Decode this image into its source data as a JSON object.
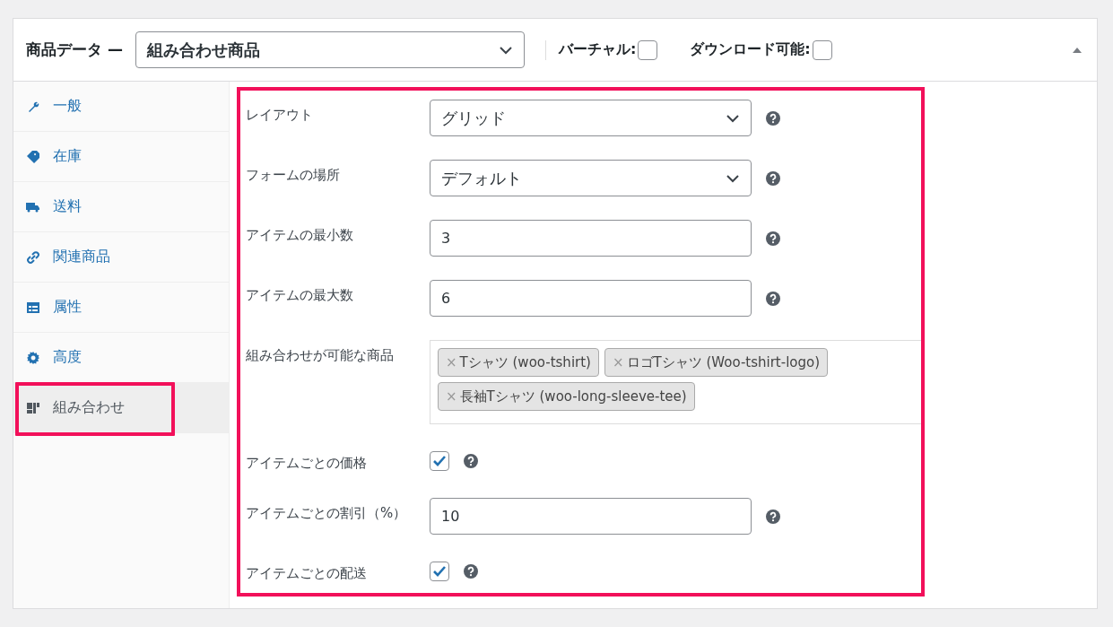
{
  "header": {
    "title": "商品データ —",
    "product_type": "組み合わせ商品",
    "options": [
      {
        "label": "バーチャル:",
        "checked": false
      },
      {
        "label": "ダウンロード可能:",
        "checked": false
      }
    ],
    "expanded": true
  },
  "tabs": [
    {
      "label": "一般",
      "selected": false,
      "highlighted": false
    },
    {
      "label": "在庫",
      "selected": false,
      "highlighted": false
    },
    {
      "label": "送料",
      "selected": false,
      "highlighted": false
    },
    {
      "label": "関連商品",
      "selected": false,
      "highlighted": false
    },
    {
      "label": "属性",
      "selected": false,
      "highlighted": false
    },
    {
      "label": "高度",
      "selected": false,
      "highlighted": false
    },
    {
      "label": "組み合わせ",
      "selected": true,
      "highlighted": true
    }
  ],
  "settings": {
    "highlighted": true,
    "fields": [
      {
        "kind": "select",
        "label": "レイアウト",
        "value": "グリッド"
      },
      {
        "kind": "select",
        "label": "フォームの場所",
        "value": "デフォルト"
      },
      {
        "kind": "number",
        "label": "アイテムの最小数",
        "value": "3"
      },
      {
        "kind": "number",
        "label": "アイテムの最大数",
        "value": "6"
      },
      {
        "kind": "tags",
        "label": "組み合わせが可能な商品",
        "tags": [
          {
            "remove": "×",
            "text": "Tシャツ (woo-tshirt)"
          },
          {
            "remove": "×",
            "text": "ロゴTシャツ (Woo-tshirt-logo)"
          },
          {
            "remove": "×",
            "text": "長袖Tシャツ (woo-long-sleeve-tee)"
          }
        ]
      },
      {
        "kind": "checkbox",
        "label": "アイテムごとの価格",
        "checked": true
      },
      {
        "kind": "number",
        "label": "アイテムごとの割引（%）",
        "value": "10"
      },
      {
        "kind": "checkbox",
        "label": "アイテムごとの配送",
        "checked": true
      }
    ]
  }
}
